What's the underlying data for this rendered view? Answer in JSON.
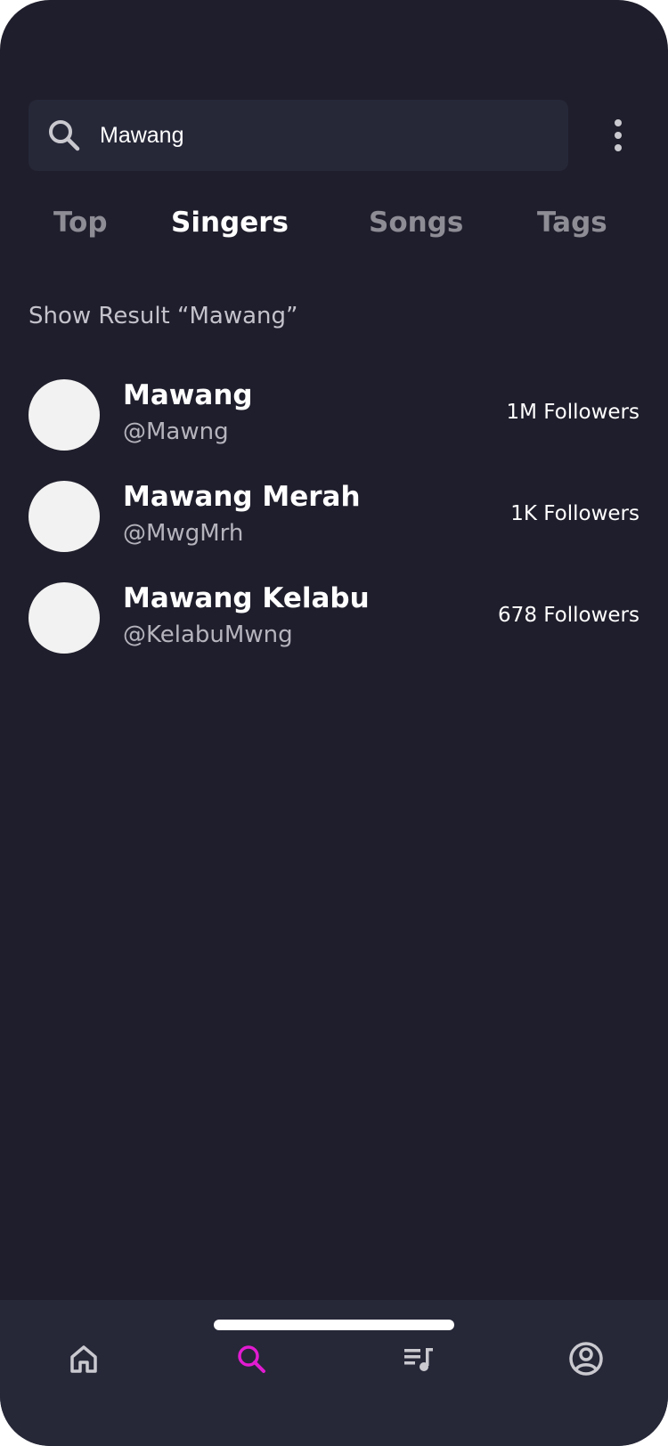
{
  "search": {
    "value": "Mawang",
    "icon": "search-icon"
  },
  "menu": {
    "icon": "more-vertical-icon"
  },
  "tabs": [
    {
      "label": "Top",
      "active": false
    },
    {
      "label": "Singers",
      "active": true
    },
    {
      "label": "Songs",
      "active": false
    },
    {
      "label": "Tags",
      "active": false
    }
  ],
  "result_heading": "Show Result “Mawang”",
  "singers": [
    {
      "name": "Mawang",
      "handle": "@Mawng",
      "followers": "1M Followers"
    },
    {
      "name": "Mawang Merah",
      "handle": "@MwgMrh",
      "followers": "1K Followers"
    },
    {
      "name": "Mawang Kelabu",
      "handle": "@KelabuMwng",
      "followers": "678 Followers"
    }
  ],
  "bottom_nav": [
    {
      "icon": "home-icon",
      "active": false
    },
    {
      "icon": "search-icon",
      "active": true
    },
    {
      "icon": "playlist-icon",
      "active": false
    },
    {
      "icon": "profile-icon",
      "active": false
    }
  ],
  "colors": {
    "background": "#1f1e2c",
    "surface": "#262838",
    "accent": "#e21bd1",
    "text": "#ffffff",
    "muted": "#8e8d96",
    "avatar": "#f2f2f2"
  }
}
